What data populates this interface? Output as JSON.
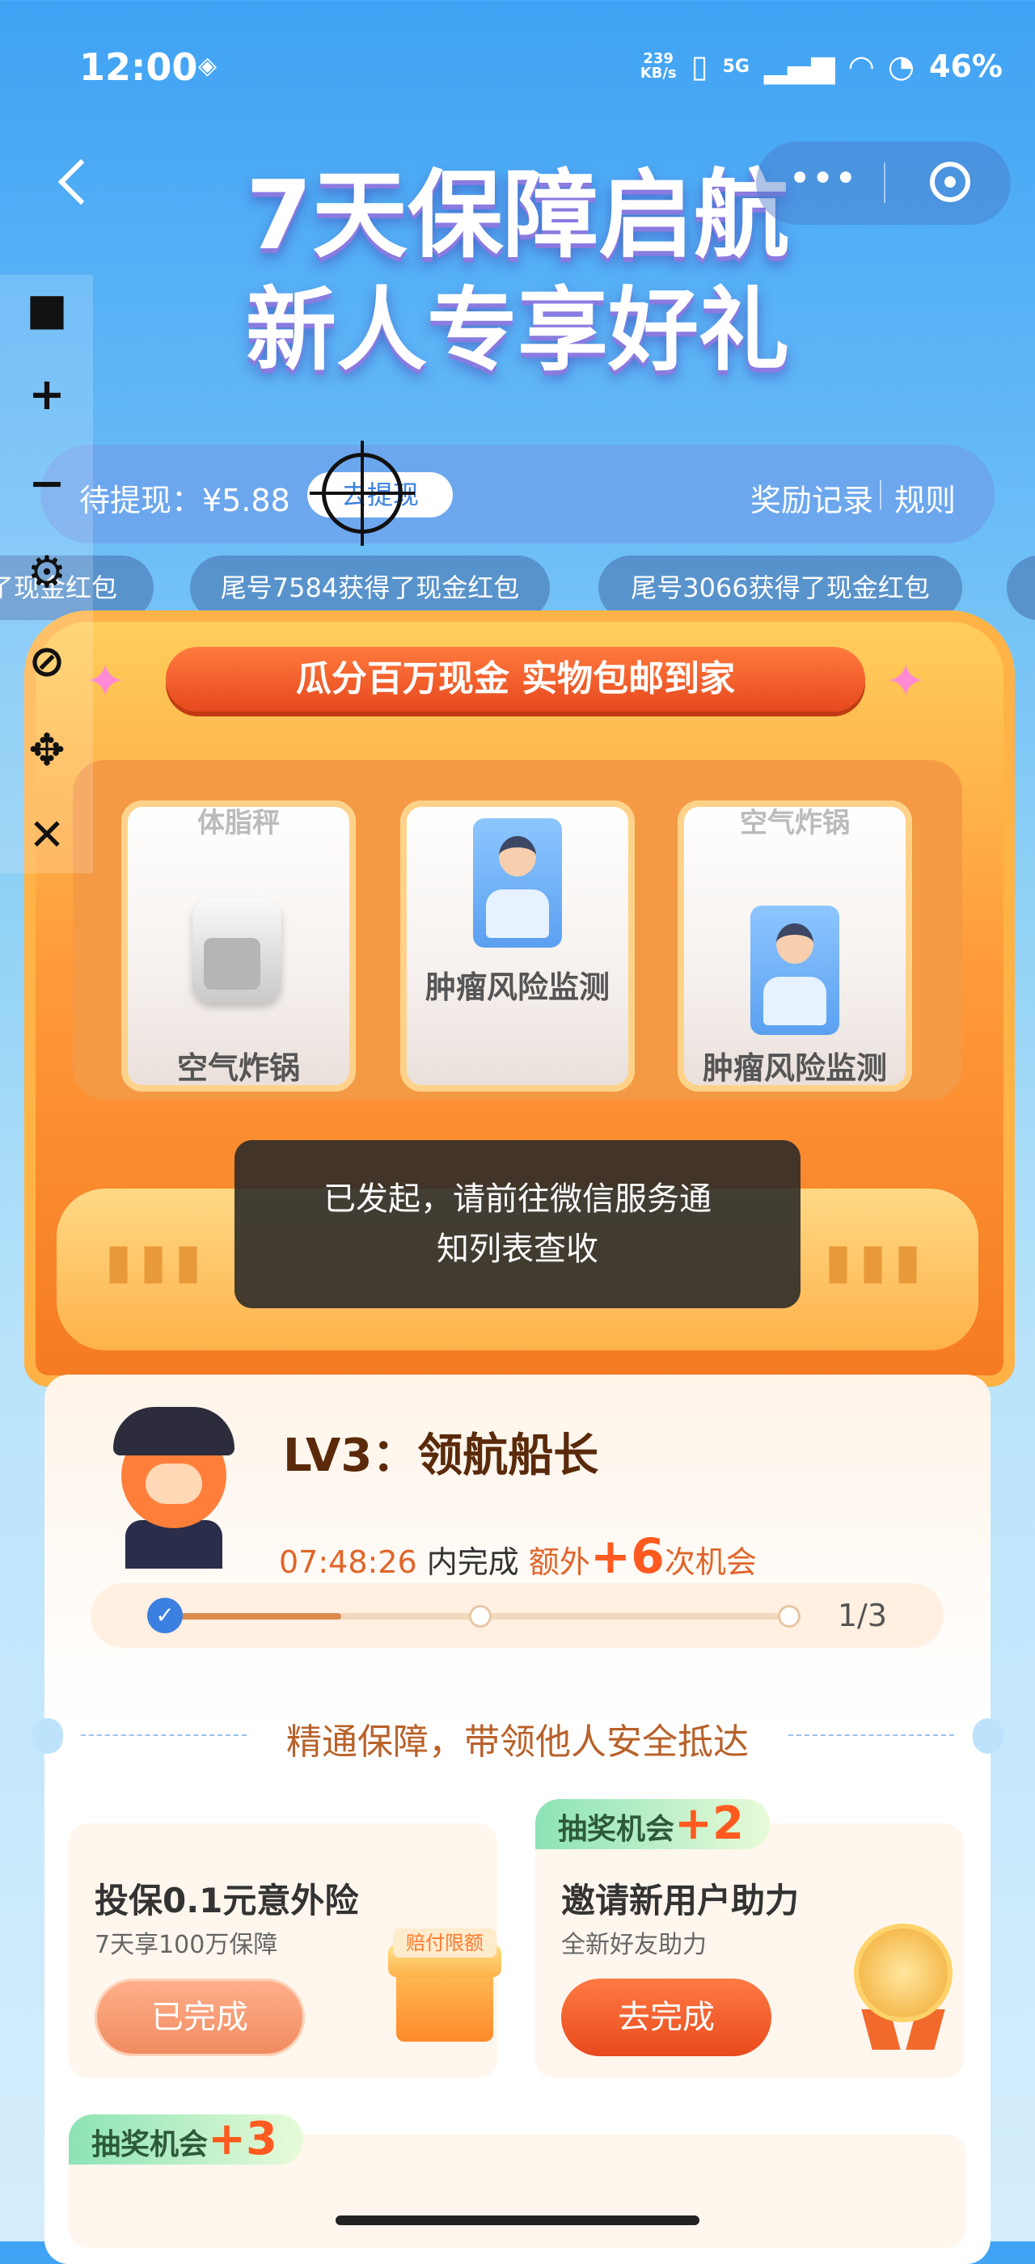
{
  "status_bar": {
    "time": "12:00",
    "net_speed": "239",
    "net_unit": "KB/s",
    "network": "5G",
    "battery": "46%"
  },
  "hero": {
    "line1": "7天保障启航",
    "line2": "新人专享好礼",
    "more": "•••"
  },
  "balance_bar": {
    "pending_label": "待提现：¥5.88",
    "withdraw_button": "去提现",
    "records": "奖励记录",
    "rules": "规则"
  },
  "ticker": [
    "了现金红包",
    "尾号7584获得了现金红包",
    "尾号3066获得了现金红包"
  ],
  "machine": {
    "banner": "瓜分百万现金 实物包邮到家",
    "reels": [
      {
        "top_faded": "体脂秤",
        "label": "空气炸锅",
        "icon": "air-fryer"
      },
      {
        "top_faded": "",
        "label": "肿瘤风险监测",
        "icon": "doctor-card"
      },
      {
        "top_faded": "空气炸锅",
        "label": "肿瘤风险监测",
        "icon": "doctor-card"
      }
    ]
  },
  "toast": {
    "line1": "已发起，请前往微信服务通",
    "line2": "知列表查收"
  },
  "level": {
    "title_prefix": "LV3：",
    "title": "领航船长",
    "countdown": "07:48:26",
    "within": "内完成",
    "extra": "额外",
    "bonus": "+6",
    "chances": "次机会",
    "progress": {
      "current": 1,
      "total": 3,
      "text": "1/3"
    }
  },
  "motto": "精通保障，带领他人安全抵达",
  "tasks": [
    {
      "tag": "",
      "title": "投保0.1元意外险",
      "subtitle": "7天享100万保障",
      "button": "已完成",
      "badge": "赔付限额",
      "status": "done"
    },
    {
      "tag": "抽奖机会",
      "tag_plus": "+2",
      "title": "邀请新用户助力",
      "subtitle": "全新好友助力",
      "button": "去完成",
      "status": "todo"
    }
  ],
  "task3": {
    "tag": "抽奖机会",
    "tag_plus": "+3"
  },
  "colors": {
    "accent": "#e84a1c",
    "primary_blue": "#3b7fe0",
    "machine_orange": "#ff9b3a"
  }
}
